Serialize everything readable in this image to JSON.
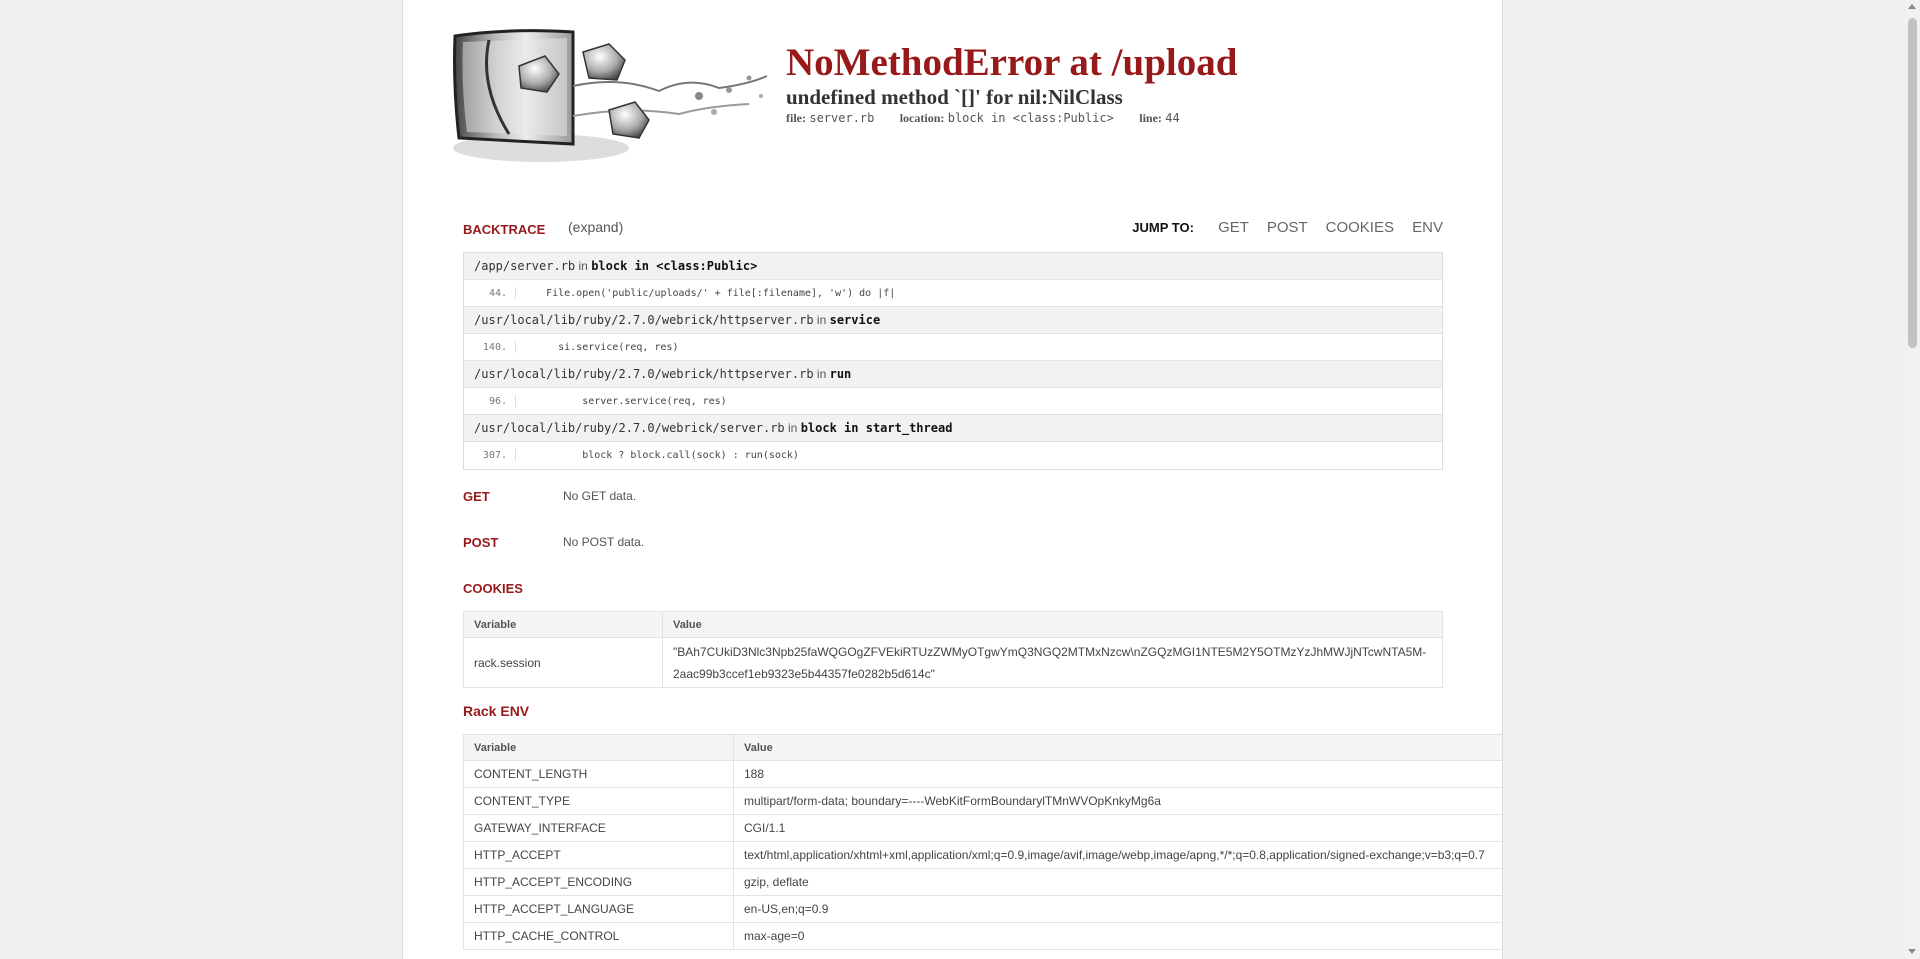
{
  "error": {
    "title": "NoMethodError at /upload",
    "message": "undefined method `[]' for nil:NilClass",
    "file_label": "file:",
    "file": "server.rb",
    "location_label": "location:",
    "location": "block in <class:Public>",
    "line_label": "line:",
    "line": "44"
  },
  "backtrace": {
    "heading": "BACKTRACE",
    "expand": "(expand)",
    "jump_label": "JUMP TO:",
    "jump_links": [
      "GET",
      "POST",
      "COOKIES",
      "ENV"
    ],
    "in_word": "in",
    "frames": [
      {
        "file": "/app/server.rb",
        "method": "block in <class:Public>",
        "line": "44.",
        "code": "    File.open('public/uploads/' + file[:filename], 'w') do |f|"
      },
      {
        "file": "/usr/local/lib/ruby/2.7.0/webrick/httpserver.rb",
        "method": "service",
        "line": "140.",
        "code": "      si.service(req, res)"
      },
      {
        "file": "/usr/local/lib/ruby/2.7.0/webrick/httpserver.rb",
        "method": "run",
        "line": "96.",
        "code": "          server.service(req, res)"
      },
      {
        "file": "/usr/local/lib/ruby/2.7.0/webrick/server.rb",
        "method": "block in start_thread",
        "line": "307.",
        "code": "          block ? block.call(sock) : run(sock)"
      }
    ]
  },
  "get": {
    "heading": "GET",
    "note": "No GET data."
  },
  "post": {
    "heading": "POST",
    "note": "No POST data."
  },
  "cookies": {
    "heading": "COOKIES",
    "col_variable": "Variable",
    "col_value": "Value",
    "rows": [
      {
        "name": "rack.session",
        "value": "\"BAh7CUkiD3Nlc3Npb25faWQGOgZFVEkiRTUzZWMyOTgwYmQ3NGQ2MTMxNzcw\\nZGQzMGI1NTE5M2Y5OTMzYzJhMWJjNTcwNTA5M-2aac99b3ccef1eb9323e5b44357fe0282b5d614c\""
      }
    ]
  },
  "env": {
    "heading": "Rack ENV",
    "col_variable": "Variable",
    "col_value": "Value",
    "rows": [
      {
        "name": "CONTENT_LENGTH",
        "value": "188"
      },
      {
        "name": "CONTENT_TYPE",
        "value": "multipart/form-data; boundary=----WebKitFormBoundarylTMnWVOpKnkyMg6a"
      },
      {
        "name": "GATEWAY_INTERFACE",
        "value": "CGI/1.1"
      },
      {
        "name": "HTTP_ACCEPT",
        "value": "text/html,application/xhtml+xml,application/xml;q=0.9,image/avif,image/webp,image/apng,*/*;q=0.8,application/signed-exchange;v=b3;q=0.7"
      },
      {
        "name": "HTTP_ACCEPT_ENCODING",
        "value": "gzip, deflate"
      },
      {
        "name": "HTTP_ACCEPT_LANGUAGE",
        "value": "en-US,en;q=0.9"
      },
      {
        "name": "HTTP_CACHE_CONTROL",
        "value": "max-age=0"
      }
    ]
  }
}
